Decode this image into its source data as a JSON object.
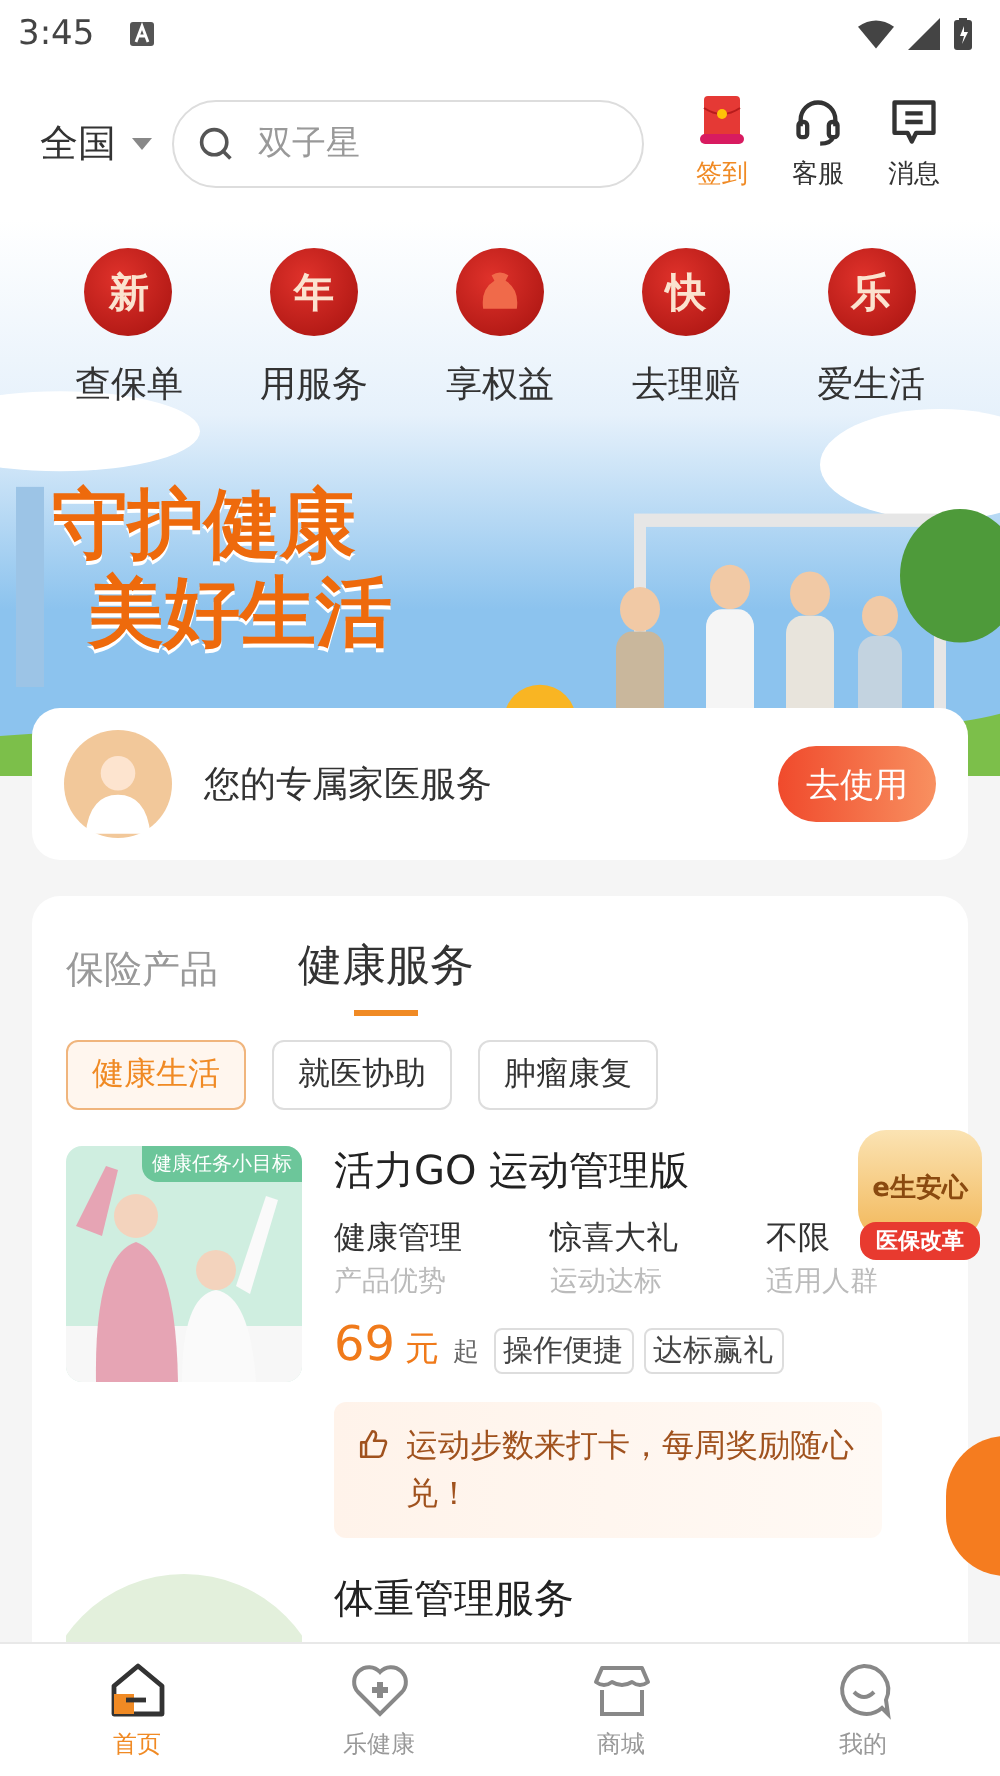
{
  "status_bar": {
    "time": "3:45"
  },
  "header": {
    "region": "全国",
    "search_placeholder": "双子星",
    "actions": [
      {
        "label": "签到",
        "kind": "signin",
        "highlight": true
      },
      {
        "label": "客服",
        "kind": "service",
        "highlight": false
      },
      {
        "label": "消息",
        "kind": "message",
        "highlight": false
      }
    ]
  },
  "shortcuts": [
    {
      "badge": "新",
      "label": "查保单"
    },
    {
      "badge": "年",
      "label": "用服务"
    },
    {
      "label": "享权益"
    },
    {
      "badge": "快",
      "label": "去理赔"
    },
    {
      "badge": "乐",
      "label": "爱生活"
    }
  ],
  "banner": {
    "headline": [
      "守护健康",
      "美好生活"
    ]
  },
  "doctor_card": {
    "text": "您的专属家医服务",
    "button": "去使用"
  },
  "section_tabs": [
    {
      "label": "保险产品",
      "selected": false
    },
    {
      "label": "健康服务",
      "selected": true
    }
  ],
  "filter_chips": [
    {
      "label": "健康生活",
      "selected": true
    },
    {
      "label": "就医协助",
      "selected": false
    },
    {
      "label": "肿瘤康复",
      "selected": false
    }
  ],
  "products": [
    {
      "title": "活力GO 运动管理版",
      "image_tag": "健康任务小目标",
      "features": [
        {
          "value": "健康管理",
          "caption": "产品优势"
        },
        {
          "value": "惊喜大礼",
          "caption": "运动达标"
        },
        {
          "value": "不限",
          "caption": "适用人群"
        }
      ],
      "price": "69",
      "unit": "元",
      "suffix": "起",
      "tags": [
        "操作便捷",
        "达标赢礼"
      ],
      "highlight": "运动步数来打卡，每周奖励随心兑！"
    },
    {
      "title": "体重管理服务"
    }
  ],
  "floating_badge": {
    "title": "e生安心",
    "ribbon": "医保改革"
  },
  "bottom_nav": [
    {
      "label": "首页",
      "kind": "home",
      "selected": true
    },
    {
      "label": "乐健康",
      "kind": "health",
      "selected": false
    },
    {
      "label": "商城",
      "kind": "shop",
      "selected": false
    },
    {
      "label": "我的",
      "kind": "profile",
      "selected": false
    }
  ]
}
